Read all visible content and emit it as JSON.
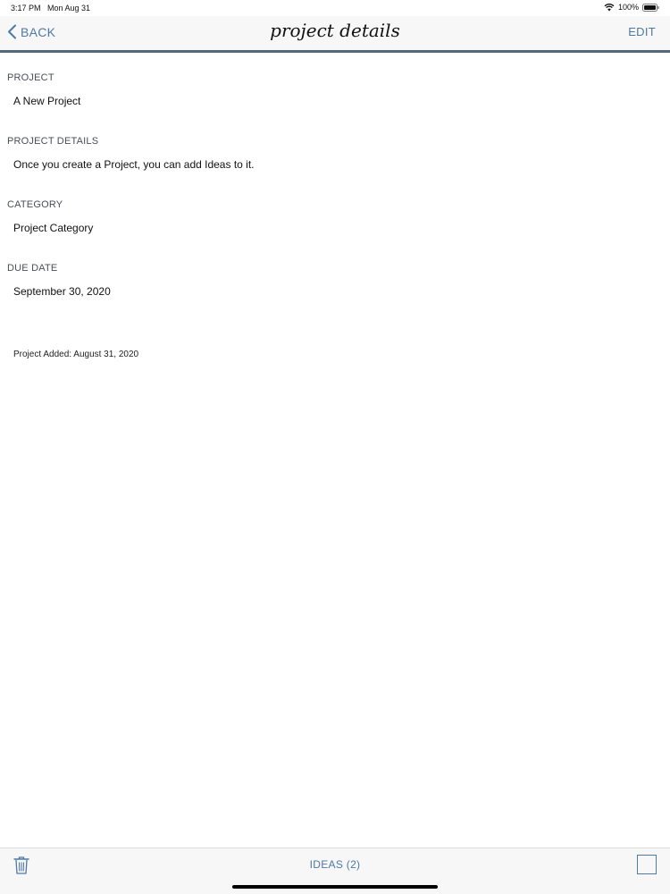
{
  "status_bar": {
    "time": "3:17 PM",
    "date": "Mon Aug 31",
    "battery": "100%"
  },
  "nav": {
    "back_label": "BACK",
    "title": "project details",
    "edit_label": "EDIT"
  },
  "fields": {
    "project": {
      "label": "PROJECT",
      "value": "A New Project"
    },
    "details": {
      "label": "PROJECT DETAILS",
      "value": "Once you create a Project, you can add Ideas to it."
    },
    "category": {
      "label": "CATEGORY",
      "value": "Project Category"
    },
    "due_date": {
      "label": "DUE DATE",
      "value": "September 30, 2020"
    }
  },
  "added_note": "Project Added: August 31, 2020",
  "toolbar": {
    "ideas_label": "IDEAS (2)",
    "icons": [
      "trash-icon",
      "square-icon"
    ]
  },
  "colors": {
    "accent": "#4e79a5",
    "nav_divider": "#56697c",
    "bar_background": "#f7f7f7"
  }
}
